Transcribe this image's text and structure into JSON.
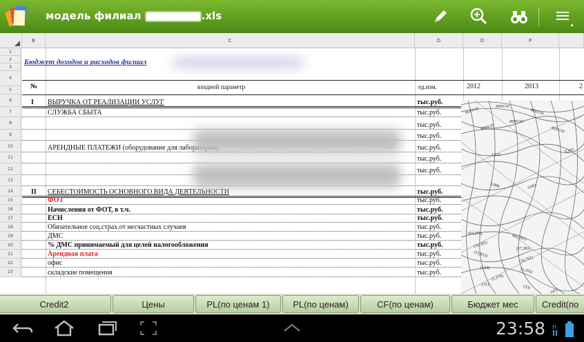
{
  "app": {
    "title_prefix": "модель филиал",
    "title_suffix": ".xls",
    "icons": [
      "app-logo-icon",
      "pencil-icon",
      "zoom-in-icon",
      "binoculars-icon",
      "menu-icon"
    ]
  },
  "sheet": {
    "columns": [
      {
        "name": "col-b",
        "label": "B"
      },
      {
        "name": "col-c",
        "label": "C"
      },
      {
        "name": "col-d",
        "label": "D"
      },
      {
        "name": "col-o",
        "label": "O"
      },
      {
        "name": "col-p",
        "label": "P"
      }
    ],
    "row_numbers": [
      "1",
      "2",
      "3",
      "4",
      "5",
      "6",
      "7",
      "8",
      "9",
      "10",
      "11",
      "12",
      "13",
      "14",
      "15",
      "16",
      "17",
      "18",
      "19",
      "20",
      "21",
      "22",
      "23"
    ],
    "budget_title": "Бюджет доходов и расходов филиал",
    "header": {
      "num": "№",
      "param": "входной параметр",
      "unit": "ед.изм.",
      "y2012": "2012",
      "y2013": "2013",
      "y2014": "2"
    },
    "rows": [
      {
        "num": "I",
        "label": "ВЫРУЧКА ОТ РЕАЛИЗАЦИИ УСЛУГ",
        "unit": "тыс.руб."
      },
      {
        "num": "",
        "label": "СЛУЖБА СБЫТА",
        "unit": "тыс.руб."
      },
      {
        "num": "",
        "label": "",
        "unit": "тыс.руб."
      },
      {
        "num": "",
        "label": "",
        "unit": "тыс.руб."
      },
      {
        "num": "",
        "label": "АРЕНДНЫЕ ПЛАТЕЖИ (оборудование для лаборатории)",
        "unit": "тыс.руб."
      },
      {
        "num": "",
        "label": "",
        "unit": "тыс.руб."
      },
      {
        "num": "",
        "label": "",
        "unit": "тыс.руб."
      },
      {
        "num": "",
        "label": "",
        "unit": ""
      },
      {
        "num": "II",
        "label": "СЕБЕСТОИМОСТЬ ОСНОВНОГО ВИДА ДЕЯТЕЛЬНОСТИ",
        "unit": "тыс.руб."
      },
      {
        "num": "",
        "label": "ФОТ",
        "unit": "тыс.руб."
      },
      {
        "num": "",
        "label": "Начисления от ФОТ, в т.ч.",
        "unit": "тыс.руб."
      },
      {
        "num": "",
        "label": "ЕСН",
        "unit": "тыс.руб."
      },
      {
        "num": "",
        "label": "Обязательное соц.страх.от несчастных случаев",
        "unit": "тыс.руб."
      },
      {
        "num": "",
        "label": "ДМС",
        "unit": "тыс.руб."
      },
      {
        "num": "",
        "label": "% ДМС принимаемый для целей налогообложения",
        "unit": "тыс.руб."
      },
      {
        "num": "",
        "label": "Арендная плата",
        "unit": "тыс.руб."
      },
      {
        "num": "",
        "label": "офис",
        "unit": "тыс.руб."
      },
      {
        "num": "",
        "label": "складские помещения",
        "unit": "тыс.руб."
      }
    ],
    "value_fragments": [
      "#DIV/0!",
      "#DIV/0!",
      "#DIV/0!",
      "#DIV/0!",
      "#DIV/0!",
      "#DIV/0!",
      "8,116",
      "1,651",
      "2,088",
      "3,091",
      "(62,252)",
      "(65,957)",
      "(16,303)",
      "(17,281)",
      "(15,813)",
      "(16,762)",
      "(124)",
      "(1,103)",
      "(1,170)",
      "(31)",
      "(33)",
      "(47)"
    ],
    "accent_red": "#e02020",
    "link_blue": "#2a3a9c"
  },
  "tabs": [
    {
      "label": "Credit2"
    },
    {
      "label": "Цены"
    },
    {
      "label": "PL(по ценам 1)"
    },
    {
      "label": "PL(по ценам)"
    },
    {
      "label": "CF(по ценам)"
    },
    {
      "label": "Бюджет мес"
    },
    {
      "label": "Credit(по"
    }
  ],
  "statusbar": {
    "time": "23:58"
  }
}
